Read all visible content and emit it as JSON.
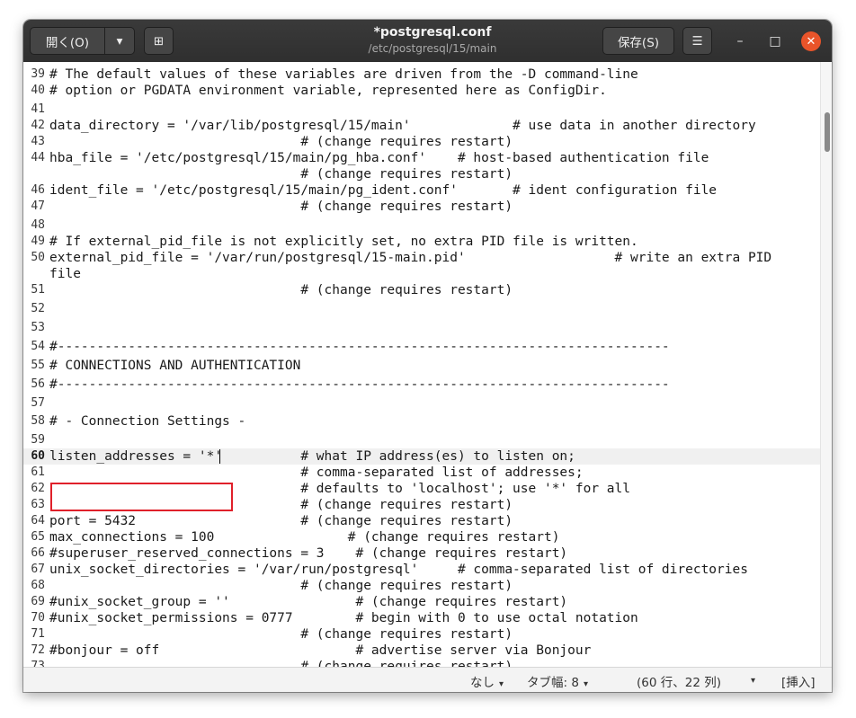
{
  "header": {
    "open_label": "開く(O)",
    "dropdown_icon": "▾",
    "new_tab_icon": "⊞",
    "title": "*postgresql.conf",
    "subtitle": "/etc/postgresql/15/main",
    "save_label": "保存(S)",
    "menu_icon": "☰",
    "minimize_icon": "–",
    "maximize_icon": "□",
    "close_icon": "✕"
  },
  "editor": {
    "current_line": 60,
    "lines": [
      {
        "n": "39",
        "text": "# The default values of these variables are driven from the -D command-line"
      },
      {
        "n": "40",
        "text": "# option or PGDATA environment variable, represented here as ConfigDir."
      },
      {
        "n": "41",
        "text": ""
      },
      {
        "n": "42",
        "text": "data_directory = '/var/lib/postgresql/15/main'             # use data in another directory"
      },
      {
        "n": "43",
        "text": "                                # (change requires restart)"
      },
      {
        "n": "44",
        "text": "hba_file = '/etc/postgresql/15/main/pg_hba.conf'    # host-based authentication file"
      },
      {
        "n": "",
        "text": "                                # (change requires restart)"
      },
      {
        "n": "46",
        "text": "ident_file = '/etc/postgresql/15/main/pg_ident.conf'       # ident configuration file"
      },
      {
        "n": "47",
        "text": "                                # (change requires restart)"
      },
      {
        "n": "48",
        "text": ""
      },
      {
        "n": "49",
        "text": "# If external_pid_file is not explicitly set, no extra PID file is written."
      },
      {
        "n": "50",
        "text": "external_pid_file = '/var/run/postgresql/15-main.pid'                   # write an extra PID"
      },
      {
        "n": "",
        "text": "file"
      },
      {
        "n": "51",
        "text": "                                # (change requires restart)"
      },
      {
        "n": "52",
        "text": ""
      },
      {
        "n": "53",
        "text": ""
      },
      {
        "n": "54",
        "text": "#------------------------------------------------------------------------------"
      },
      {
        "n": "55",
        "text": "# CONNECTIONS AND AUTHENTICATION"
      },
      {
        "n": "56",
        "text": "#------------------------------------------------------------------------------"
      },
      {
        "n": "57",
        "text": ""
      },
      {
        "n": "58",
        "text": "# - Connection Settings -"
      },
      {
        "n": "59",
        "text": ""
      },
      {
        "n": "60",
        "text": "listen_addresses = '*'          # what IP address(es) to listen on;"
      },
      {
        "n": "61",
        "text": "                                # comma-separated list of addresses;"
      },
      {
        "n": "62",
        "text": "                                # defaults to 'localhost'; use '*' for all"
      },
      {
        "n": "63",
        "text": "                                # (change requires restart)"
      },
      {
        "n": "64",
        "text": "port = 5432                     # (change requires restart)"
      },
      {
        "n": "65",
        "text": "max_connections = 100                 # (change requires restart)"
      },
      {
        "n": "66",
        "text": "#superuser_reserved_connections = 3    # (change requires restart)"
      },
      {
        "n": "67",
        "text": "unix_socket_directories = '/var/run/postgresql'     # comma-separated list of directories"
      },
      {
        "n": "68",
        "text": "                                # (change requires restart)"
      },
      {
        "n": "69",
        "text": "#unix_socket_group = ''                # (change requires restart)"
      },
      {
        "n": "70",
        "text": "#unix_socket_permissions = 0777        # begin with 0 to use octal notation"
      },
      {
        "n": "71",
        "text": "                                # (change requires restart)"
      },
      {
        "n": "72",
        "text": "#bonjour = off                         # advertise server via Bonjour"
      },
      {
        "n": "73",
        "text": "                                # (change requires restart)"
      }
    ]
  },
  "status": {
    "language": "なし",
    "tab_width": "タブ幅: 8",
    "position": "(60 行、22 列)",
    "mode": "[挿入]",
    "dropdown_icon": "▾"
  }
}
